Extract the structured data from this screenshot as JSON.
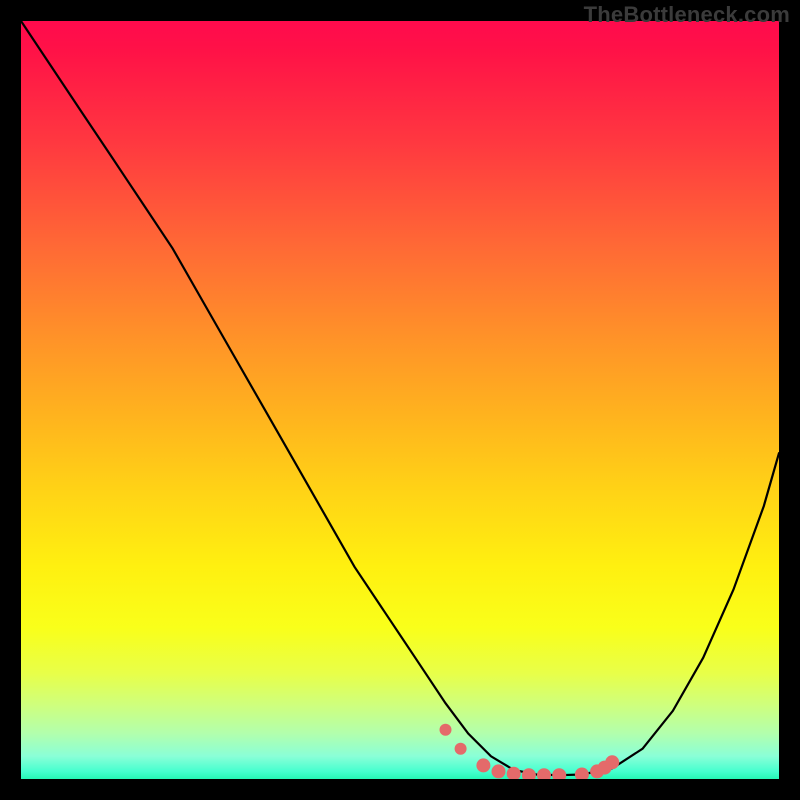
{
  "watermark": "TheBottleneck.com",
  "chart_data": {
    "type": "line",
    "title": "",
    "xlabel": "",
    "ylabel": "",
    "xlim": [
      0,
      100
    ],
    "ylim": [
      0,
      100
    ],
    "grid": false,
    "legend": false,
    "series": [
      {
        "name": "bottleneck-curve",
        "x": [
          0,
          4,
          8,
          12,
          16,
          20,
          24,
          28,
          32,
          36,
          40,
          44,
          48,
          52,
          56,
          59,
          62,
          65,
          68,
          71,
          74,
          78,
          82,
          86,
          90,
          94,
          98,
          100
        ],
        "y": [
          100,
          94,
          88,
          82,
          76,
          70,
          63,
          56,
          49,
          42,
          35,
          28,
          22,
          16,
          10,
          6,
          3,
          1.2,
          0.6,
          0.5,
          0.6,
          1.4,
          4,
          9,
          16,
          25,
          36,
          43
        ]
      },
      {
        "name": "highlight-dots",
        "x": [
          56,
          58,
          61,
          63,
          65,
          67,
          69,
          71,
          74,
          76,
          77,
          78
        ],
        "y": [
          6.5,
          4,
          1.8,
          1.0,
          0.7,
          0.5,
          0.5,
          0.5,
          0.6,
          1.0,
          1.5,
          2.2
        ]
      }
    ],
    "colors": {
      "curve": "#000000",
      "dots": "#e46a6a"
    }
  }
}
